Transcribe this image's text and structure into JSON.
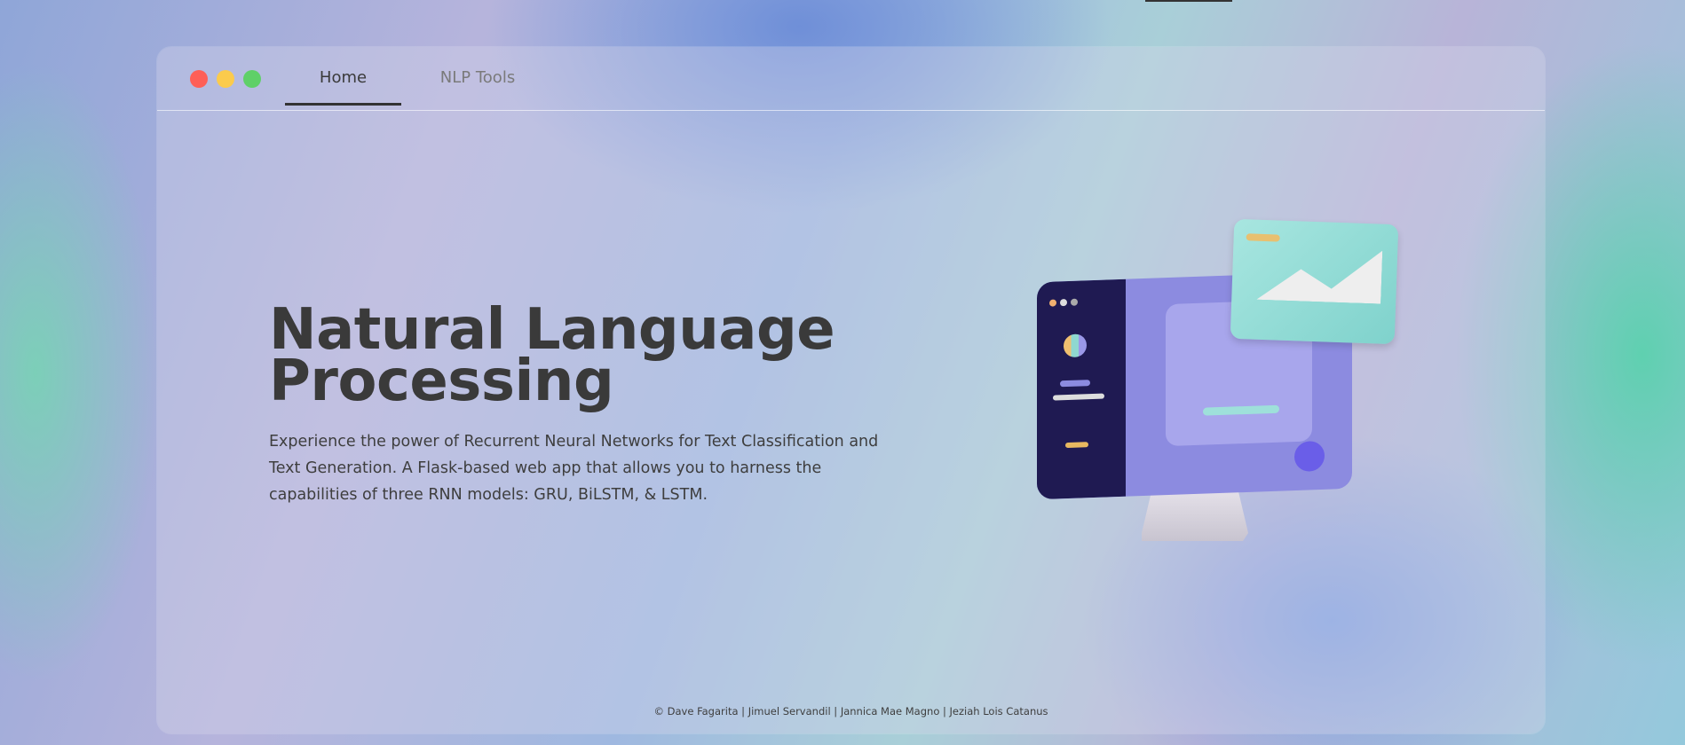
{
  "nav": {
    "dots": [
      "#fe5f57",
      "#fbcb4c",
      "#5fd068"
    ],
    "tabs": [
      {
        "label": "Home",
        "active": true
      },
      {
        "label": "NLP Tools",
        "active": false
      }
    ]
  },
  "hero": {
    "title_line1": "Natural Language",
    "title_line2": "Processing",
    "description": "Experience the power of Recurrent Neural Networks for Text Classification and Text Generation. A Flask-based web app that allows you to harness the capabilities of three RNN models: GRU, BiLSTM, & LSTM."
  },
  "footer": {
    "text": "© Dave Fagarita | Jimuel Servandil | Jannica Mae Magno | Jeziah Lois Catanus"
  }
}
